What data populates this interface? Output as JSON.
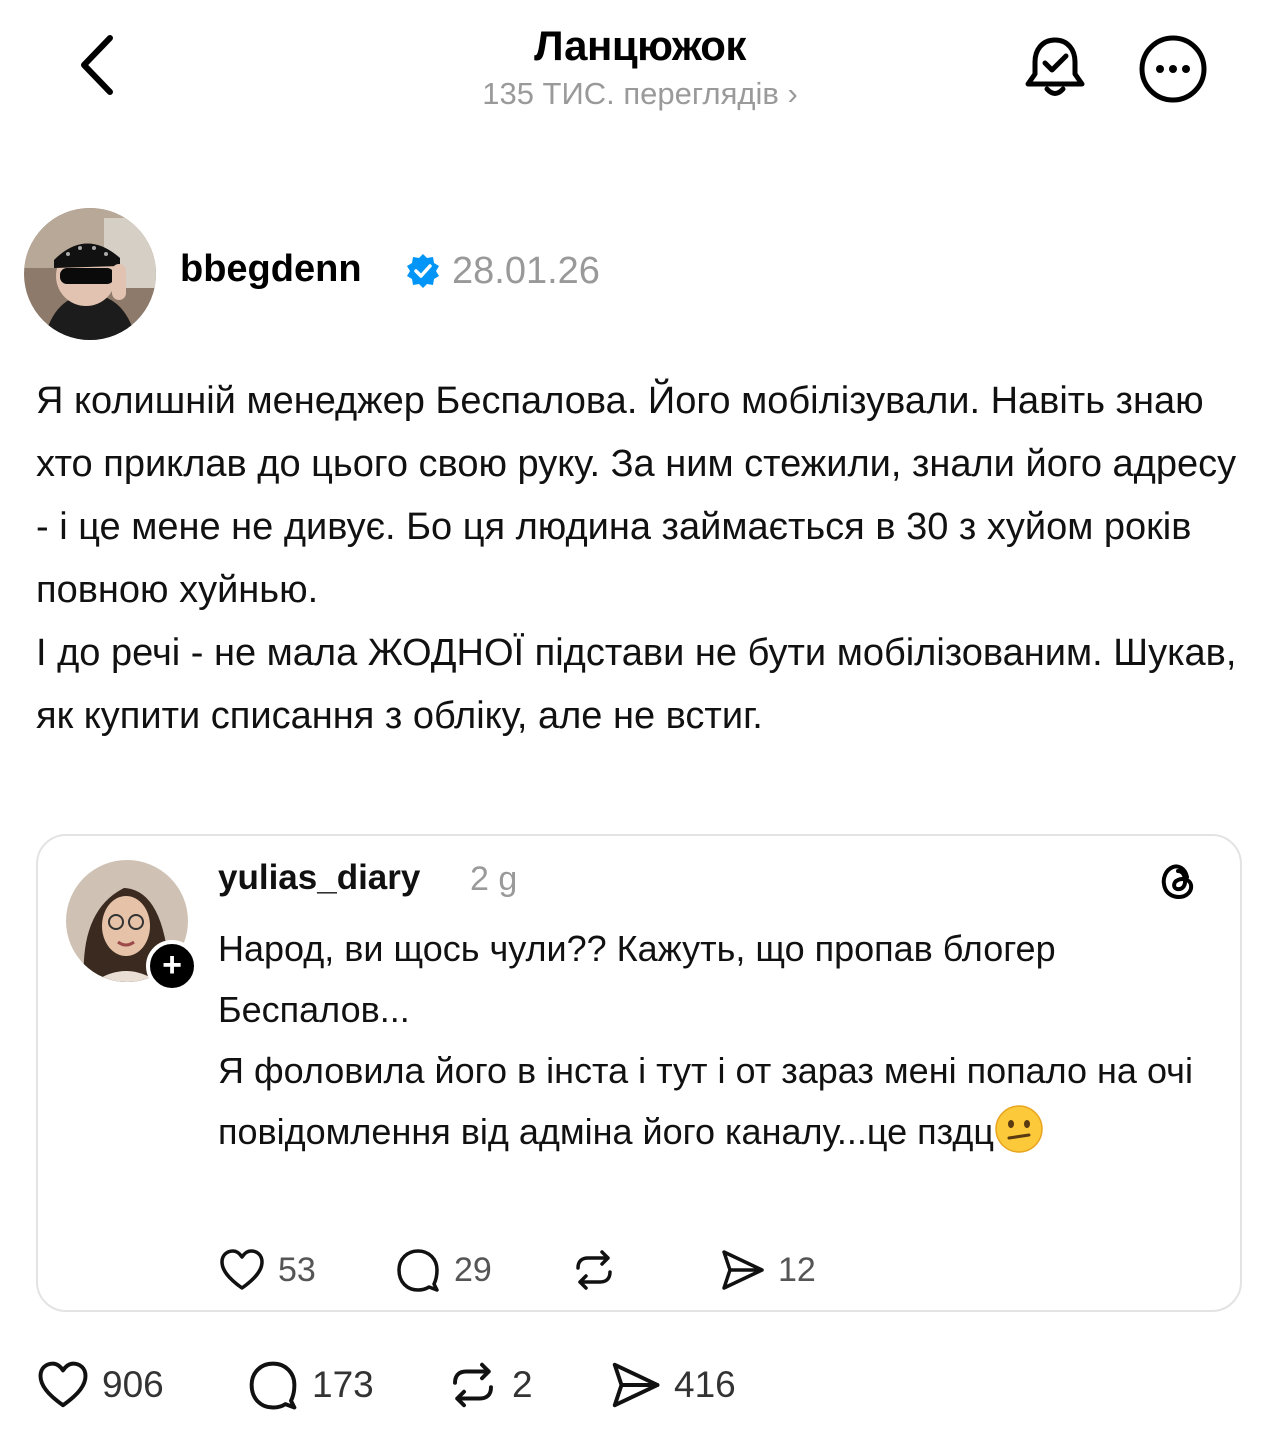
{
  "header": {
    "title": "Ланцюжок",
    "views": "135 ТИС. переглядів ›"
  },
  "post": {
    "username": "bbegdenn",
    "date": "28.01.26",
    "paragraph1": "Я колишній менеджер Беспалова. Його мобілізували. Навіть знаю хто приклав до цього свою руку. За ним стежили, знали його адресу - і це мене не дивує. Бо ця людина займається в 30 з хуйом років повною хуйнью.",
    "paragraph2": "І до речі - не мала ЖОДНОЇ підстави не бути мобілізованим. Шукав, як купити списання з обліку, але не встиг.",
    "likes": "906",
    "comments": "173",
    "reposts": "2",
    "shares": "416"
  },
  "quote": {
    "username": "yulias_diary",
    "time": "2 g",
    "paragraph1": "Народ, ви щось чули?? Кажуть, що пропав блогер Беспалов...",
    "paragraph2": "Я фоловила його в інста і тут і от зараз мені попало на очі повідомлення від адміна його каналу...це пздц",
    "likes": "53",
    "comments": "29",
    "shares": "12",
    "plus": "+"
  },
  "icons": {
    "back": "chevron-left-icon",
    "bell": "bell-check-icon",
    "more": "more-horizontal-icon",
    "verified": "verified-badge-icon",
    "threads": "threads-logo-icon",
    "like": "heart-icon",
    "comment": "comment-bubble-icon",
    "repost": "repost-icon",
    "share": "send-icon",
    "emoji": "confused-face-emoji"
  },
  "colors": {
    "verified": "#0095f6",
    "muted": "#9a9a9a",
    "border": "#e3e3e3"
  }
}
